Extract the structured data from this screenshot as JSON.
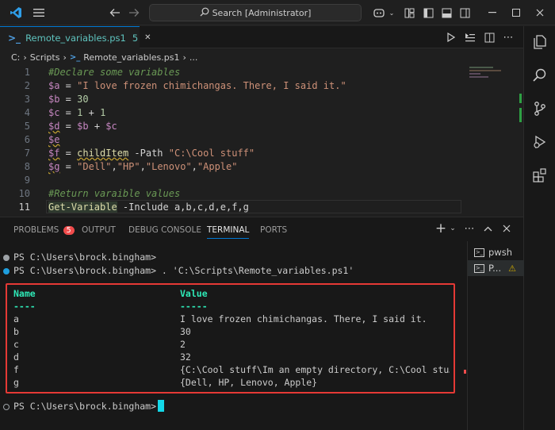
{
  "titlebar": {
    "search_text": "Search [Administrator]",
    "icons": [
      "vscode-icon",
      "menu-icon",
      "back-icon",
      "forward-icon",
      "search-icon",
      "copilot-icon",
      "layout-icon",
      "toggle-primary-sidebar-icon",
      "toggle-panel-icon",
      "toggle-secondary-sidebar-icon",
      "minimize-icon",
      "maximize-icon",
      "close-icon"
    ]
  },
  "tab": {
    "label": "Remote_variables.ps1",
    "problem_count": "5",
    "close": "✕"
  },
  "breadcrumb": {
    "drive": "C:",
    "folder": "Scripts",
    "file": "Remote_variables.ps1",
    "more": "..."
  },
  "editor": {
    "line_numbers": [
      "1",
      "2",
      "3",
      "4",
      "5",
      "6",
      "7",
      "8",
      "9",
      "10",
      "11"
    ],
    "lines": {
      "l1": "#Declare some variables",
      "l2_var": "$a",
      "l2_eq": " = ",
      "l2_str": "\"I love frozen chimichangas. There, I said it.\"",
      "l3_var": "$b",
      "l3_eq": " = ",
      "l3_num": "30",
      "l4_var": "$c",
      "l4_eq": " = ",
      "l4_n1": "1",
      "l4_plus": " + ",
      "l4_n2": "1",
      "l5_var": "$d",
      "l5_eq": " = ",
      "l5_b": "$b",
      "l5_plus": " + ",
      "l5_c": "$c",
      "l6_var": "$e",
      "l7_var": "$f",
      "l7_eq": " = ",
      "l7_cmd": "childItem",
      "l7_param": " -Path ",
      "l7_str": "\"C:\\Cool stuff\"",
      "l8_var": "$g",
      "l8_eq": " = ",
      "l8_s1": "\"Dell\"",
      "l8_c1": ",",
      "l8_s2": "\"HP\"",
      "l8_c2": ",",
      "l8_s3": "\"Lenovo\"",
      "l8_c3": ",",
      "l8_s4": "\"Apple\"",
      "l10": "#Return varaible values",
      "l11_cmd": "Get-Variable",
      "l11_rest": " -Include a,b,c,d,e,f,g"
    }
  },
  "panel": {
    "tabs": {
      "problems": "PROBLEMS",
      "problems_badge": "5",
      "output": "OUTPUT",
      "debug": "DEBUG CONSOLE",
      "terminal": "TERMINAL",
      "ports": "PORTS"
    },
    "terminal_list": {
      "pwsh": "pwsh",
      "second": "P..."
    },
    "prompt1": "PS C:\\Users\\brock.bingham>",
    "prompt2": "PS C:\\Users\\brock.bingham> . 'C:\\Scripts\\Remote_variables.ps1'",
    "table": {
      "headers": [
        "Name",
        "Value"
      ],
      "dashes": [
        "----",
        "-----"
      ],
      "rows": [
        [
          "a",
          "I love frozen chimichangas. There, I said it."
        ],
        [
          "b",
          "30"
        ],
        [
          "c",
          "2"
        ],
        [
          "d",
          "32"
        ],
        [
          "f",
          "{C:\\Cool stuff\\Im an empty directory, C:\\Cool stu…"
        ],
        [
          "g",
          "{Dell, HP, Lenovo, Apple}"
        ]
      ]
    },
    "prompt3": "PS C:\\Users\\brock.bingham>"
  },
  "colors": {
    "accent": "#0078d4",
    "highlight_box": "#e53935",
    "badge": "#f14c4c",
    "cursor": "#13d8e8"
  }
}
